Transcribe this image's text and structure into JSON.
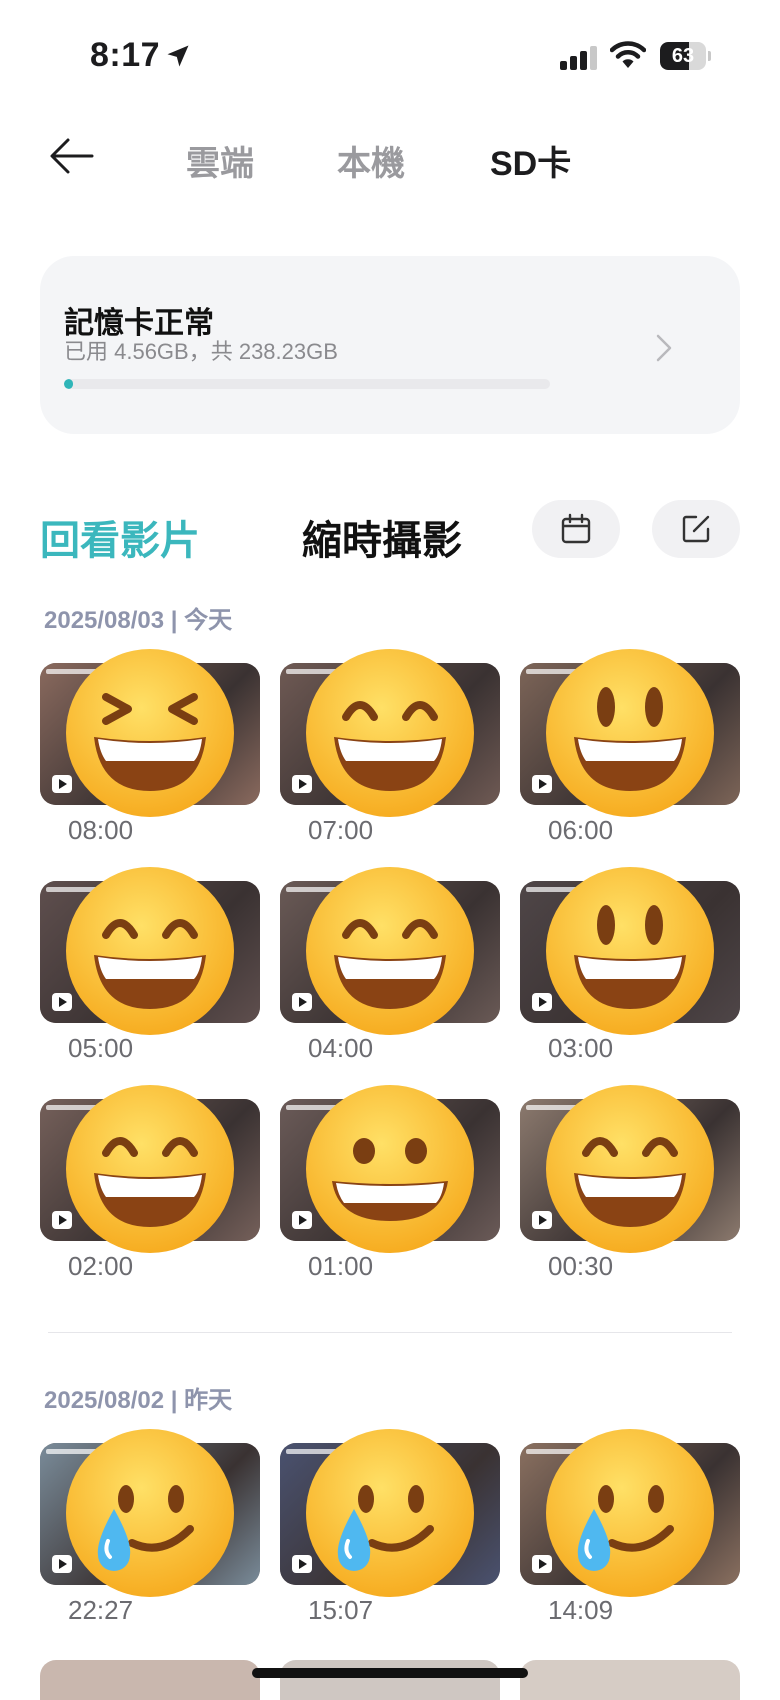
{
  "status_bar": {
    "time": "8:17",
    "battery": "63",
    "battery_level": 0.63
  },
  "nav": {
    "tabs": [
      "雲端",
      "本機",
      "SD卡"
    ],
    "active_tab": "SD卡"
  },
  "storage": {
    "title": "記憶卡正常",
    "usage": "已用 4.56GB，共 238.23GB",
    "used_fraction": 0.019
  },
  "sections": {
    "playback": "回看影片",
    "timelapse": "縮時攝影"
  },
  "groups": [
    {
      "date": "2025/08/03 | 今天",
      "items": [
        {
          "time": "08:00",
          "emoji": "laughing-face"
        },
        {
          "time": "07:00",
          "emoji": "grinning-squint-face"
        },
        {
          "time": "06:00",
          "emoji": "grinning-face-big-eyes"
        },
        {
          "time": "05:00",
          "emoji": "grinning-squint-face"
        },
        {
          "time": "04:00",
          "emoji": "grinning-squint-face"
        },
        {
          "time": "03:00",
          "emoji": "grinning-face-big-eyes"
        },
        {
          "time": "02:00",
          "emoji": "grinning-squint-face"
        },
        {
          "time": "01:00",
          "emoji": "grinning-face"
        },
        {
          "time": "00:30",
          "emoji": "grinning-squint-face"
        }
      ]
    },
    {
      "date": "2025/08/02 | 昨天",
      "items": [
        {
          "time": "22:27",
          "emoji": "smiling-face-with-tear"
        },
        {
          "time": "15:07",
          "emoji": "smiling-face-with-tear"
        },
        {
          "time": "14:09",
          "emoji": "smiling-face-with-tear"
        }
      ]
    }
  ],
  "colors": {
    "accent": "#3bb7bd",
    "emoji": "#ffc62b",
    "text_muted": "#8e94ac"
  }
}
